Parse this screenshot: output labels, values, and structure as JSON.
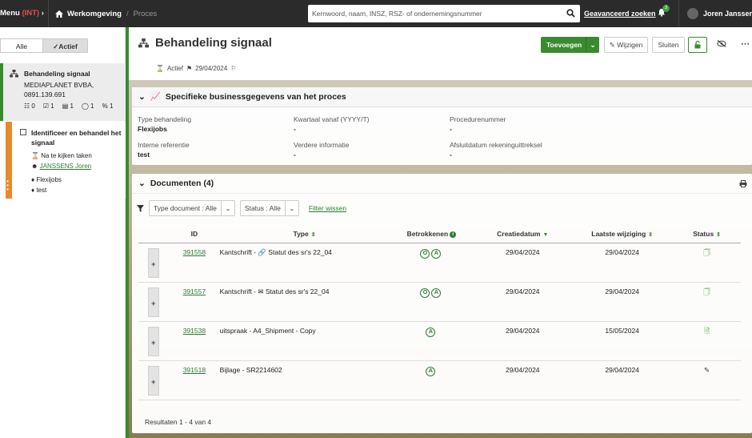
{
  "topbar": {
    "menu_label": "Menu",
    "env": "(INT)",
    "home_label": "Werkomgeving",
    "crumb_current": "Proces",
    "search_placeholder": "Kernwoord, naam, INSZ, RSZ- of ondernemingsnummer",
    "advanced_search": "Geavanceerd zoeken",
    "notif_count": "3",
    "user_name": "Joren Janssens"
  },
  "left": {
    "filter_all": "Alle",
    "filter_active": "Actief",
    "process": {
      "title": "Behandeling signaal",
      "company": "MEDIAPLANET BVBA,",
      "number": "0891.139.691",
      "counts": [
        "0",
        "1",
        "1",
        "1",
        "1"
      ]
    },
    "task": {
      "title": "Identificeer en behandel het signaal",
      "status": "Na te kijken taken",
      "assignee": "JANSSENS Joren",
      "tags": [
        "Flexijobs",
        "test"
      ]
    }
  },
  "header": {
    "title": "Behandeling signaal",
    "status": "Actief",
    "date": "29/04/2024",
    "add_button": "Toevoegen",
    "edit_button": "Wijzigen",
    "close_button": "Sluiten"
  },
  "business": {
    "title": "Specifieke businessgegevens van het proces",
    "fields": [
      {
        "label": "Type behandeling",
        "value": "Flexijobs"
      },
      {
        "label": "Kwartaal vanaf (YYYY/T)",
        "value": "-"
      },
      {
        "label": "Procedurenummer",
        "value": "-"
      },
      {
        "label": "Interne referentie",
        "value": "test"
      },
      {
        "label": "Verdere informatie",
        "value": "-"
      },
      {
        "label": "Afsluitdatum rekeninguittreksel",
        "value": "-"
      }
    ]
  },
  "documents": {
    "title": "Documenten (4)",
    "filter_type": "Type document : Alle",
    "filter_status": "Status : Alle",
    "clear_filter": "Filter wissen",
    "columns": [
      "ID",
      "Type",
      "Betrokkenen",
      "Creatiedatum",
      "Laatste wijziging",
      "Status"
    ],
    "rows": [
      {
        "id": "391558",
        "type": "Kantschrift - 🔗 Statut des sr's 22_04",
        "persons": [
          "O",
          "A"
        ],
        "created": "29/04/2024",
        "modified": "29/04/2024"
      },
      {
        "id": "391557",
        "type": "Kantschrift - ✉ Statut des sr's 22_04",
        "persons": [
          "O",
          "A"
        ],
        "created": "29/04/2024",
        "modified": "29/04/2024"
      },
      {
        "id": "391538",
        "type": "uitspraak - A4_Shipment - Copy",
        "persons": [
          "A"
        ],
        "created": "29/04/2024",
        "modified": "15/05/2024"
      },
      {
        "id": "391518",
        "type": "Bijlage - SR2214602",
        "persons": [
          "A"
        ],
        "created": "29/04/2024",
        "modified": "29/04/2024"
      }
    ],
    "results": "Resultaten 1 - 4 van 4"
  },
  "colors": {
    "accent": "#3a8a2f",
    "task": "#e88a2a",
    "topbar": "#2b2b2b"
  }
}
